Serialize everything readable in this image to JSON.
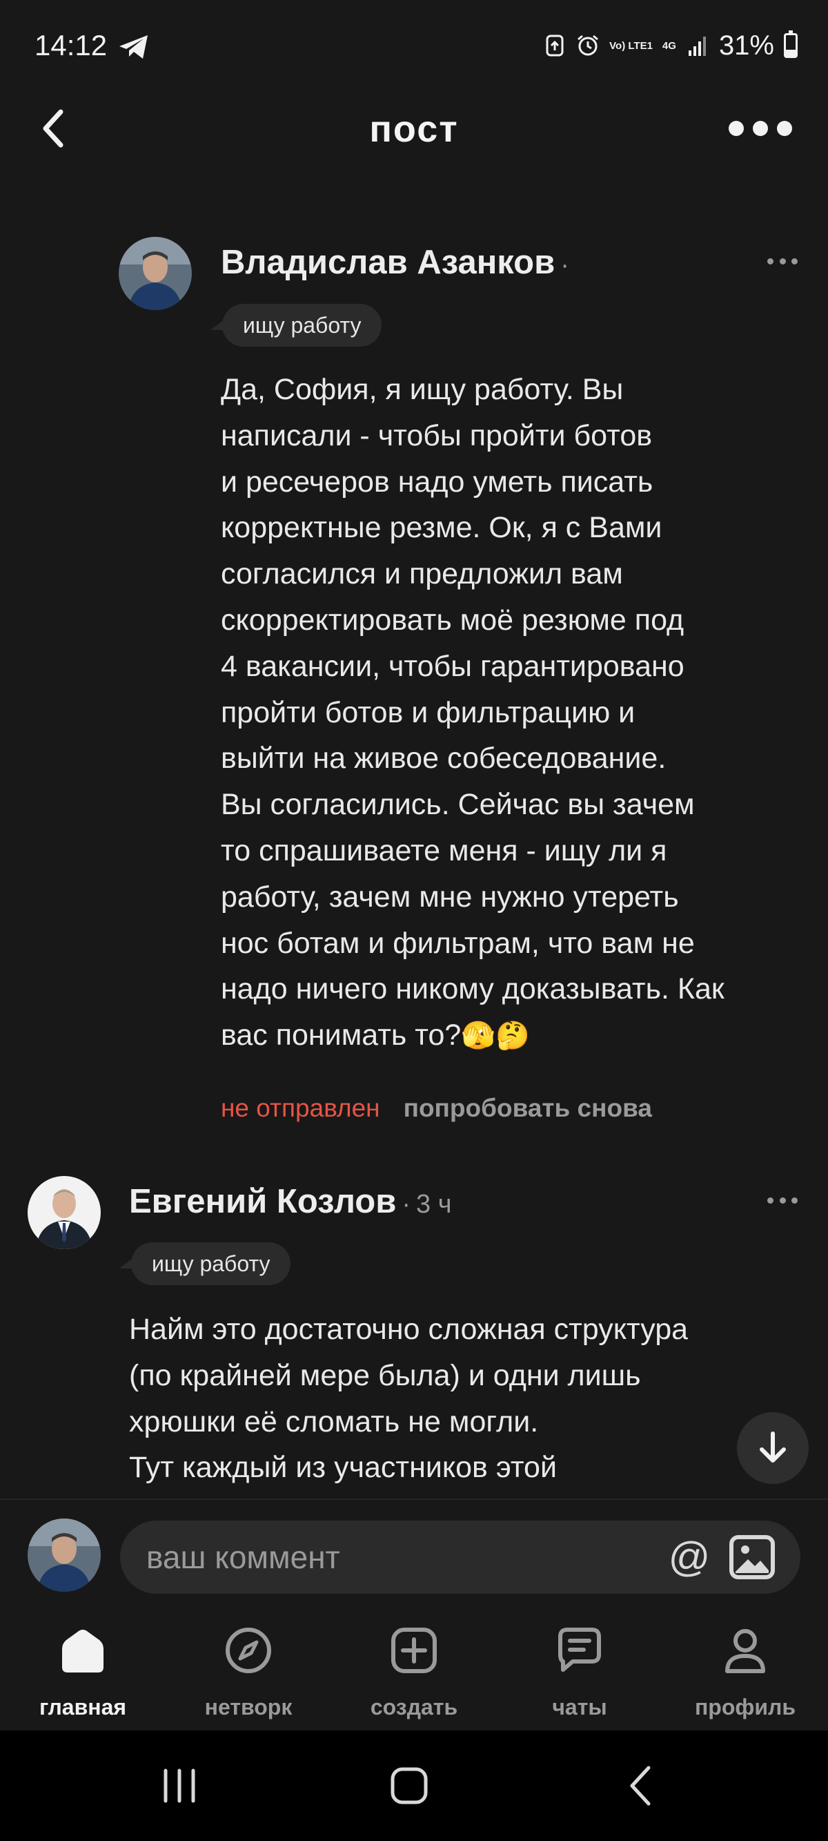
{
  "status_bar": {
    "time": "14:12",
    "network_label": "Vo) LTE1",
    "network_type": "4G",
    "battery_percent": "31%",
    "battery_level": 0.31,
    "icons": [
      "telegram-icon",
      "data-saver-icon",
      "alarm-icon",
      "signal-icon",
      "battery-icon"
    ]
  },
  "header": {
    "title": "пост",
    "back_icon": "chevron-left-icon",
    "more_icon": "more-horizontal-icon"
  },
  "comments": [
    {
      "author": "Владислав Азанков",
      "time": "",
      "tag": "ищу работу",
      "text": "Да, София, я ищу работу. Вы\nнаписали - чтобы пройти ботов\nи ресечеров надо уметь писать\nкорректные резме. Ок, я с Вами\nсогласился и предложил вам\nскорректировать моё резюме под\n4 вакансии, чтобы гарантировано\nпройти ботов и фильтрацию и\nвыйти на живое собеседование.\nВы согласились. Сейчас вы зачем\nто спрашиваете меня - ищу ли я\nработу, зачем мне нужно утереть\nнос ботам и фильтрам, что вам не\nнадо ничего никому доказывать. Как\nвас понимать то?",
      "emoji": "🫣🤔",
      "status": "не отправлен",
      "retry_label": "попробовать снова"
    },
    {
      "author": "Евгений Козлов",
      "time": "3 ч",
      "tag": "ищу работу",
      "text": "Найм это достаточно сложная структура\n(по крайней мере была) и одни лишь\nхрюшки её сломать не могли.\nТут каждый из участников этой"
    }
  ],
  "composer": {
    "placeholder": "ваш коммент",
    "mention_symbol": "@",
    "image_icon": "image-icon"
  },
  "bottom_nav": [
    {
      "label": "главная",
      "icon": "home-icon",
      "active": true
    },
    {
      "label": "нетворк",
      "icon": "compass-icon",
      "active": false
    },
    {
      "label": "создать",
      "icon": "plus-square-icon",
      "active": false
    },
    {
      "label": "чаты",
      "icon": "chat-icon",
      "active": false
    },
    {
      "label": "профиль",
      "icon": "user-icon",
      "active": false
    }
  ],
  "system_nav": [
    "recent-apps-icon",
    "home-button-icon",
    "back-icon"
  ],
  "colors": {
    "background": "#181818",
    "error_red": "#e65444",
    "muted_gray": "#9a9a9a",
    "chip_bg": "#2b2b2b"
  }
}
